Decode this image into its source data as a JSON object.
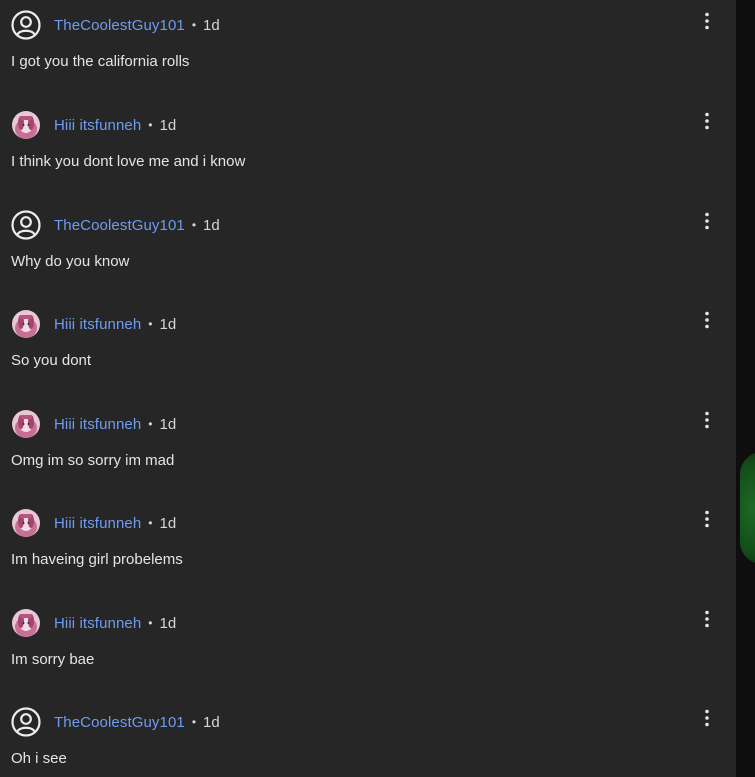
{
  "colors": {
    "background": "#262626",
    "username": "#6f9cf0",
    "text": "#e4e4e4",
    "meta": "#d6d6d6"
  },
  "comments": [
    {
      "user": "TheCoolestGuy101",
      "avatar": "default-user-icon",
      "age": "1d",
      "text": "I got you the california rolls"
    },
    {
      "user": "Hiii itsfunneh",
      "avatar": "profile-photo",
      "age": "1d",
      "text": "I think you dont love me and i know"
    },
    {
      "user": "TheCoolestGuy101",
      "avatar": "default-user-icon",
      "age": "1d",
      "text": "Why do you know"
    },
    {
      "user": "Hiii itsfunneh",
      "avatar": "profile-photo",
      "age": "1d",
      "text": "So you dont"
    },
    {
      "user": "Hiii itsfunneh",
      "avatar": "profile-photo",
      "age": "1d",
      "text": "Omg im so sorry im mad"
    },
    {
      "user": "Hiii itsfunneh",
      "avatar": "profile-photo",
      "age": "1d",
      "text": "Im haveing girl probelems"
    },
    {
      "user": "Hiii itsfunneh",
      "avatar": "profile-photo",
      "age": "1d",
      "text": "Im sorry bae"
    },
    {
      "user": "TheCoolestGuy101",
      "avatar": "default-user-icon",
      "age": "1d",
      "text": "Oh i see"
    }
  ],
  "separator": "•"
}
